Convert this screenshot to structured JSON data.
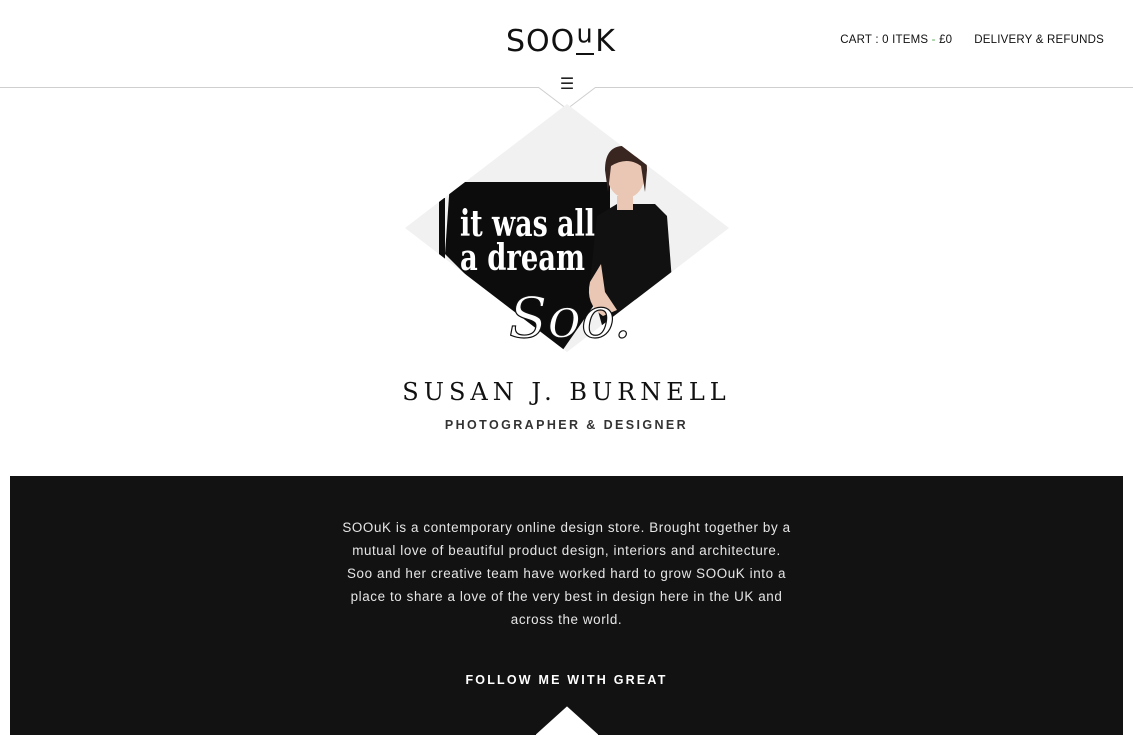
{
  "header": {
    "logo": {
      "prefix": "SOO",
      "u": "u",
      "suffix": "K"
    },
    "cart_label": "CART : 0 ITEMS",
    "cart_separator": " - ",
    "cart_total": "£0",
    "delivery_label": "DELIVERY & REFUNDS",
    "menu_icon": "menu-icon"
  },
  "hero": {
    "graphic_line1": "it was all",
    "graphic_line2": "a dream",
    "signature": "Soo."
  },
  "profile": {
    "name": "SUSAN J. BURNELL",
    "role": "PHOTOGRAPHER & DESIGNER"
  },
  "about": {
    "lines": [
      "SOOuK is a contemporary online design store. Brought together by a",
      "mutual love of beautiful product design, interiors and architecture.",
      "Soo and her creative team have worked hard to grow SOOuK into a",
      "place to share a love of the very best in design here in the UK and",
      "across the world."
    ],
    "follow_label": "FOLLOW ME WITH GREAT"
  },
  "colors": {
    "band": "#121212",
    "text_light": "#e6e6e6",
    "accent_text": "#111111"
  }
}
